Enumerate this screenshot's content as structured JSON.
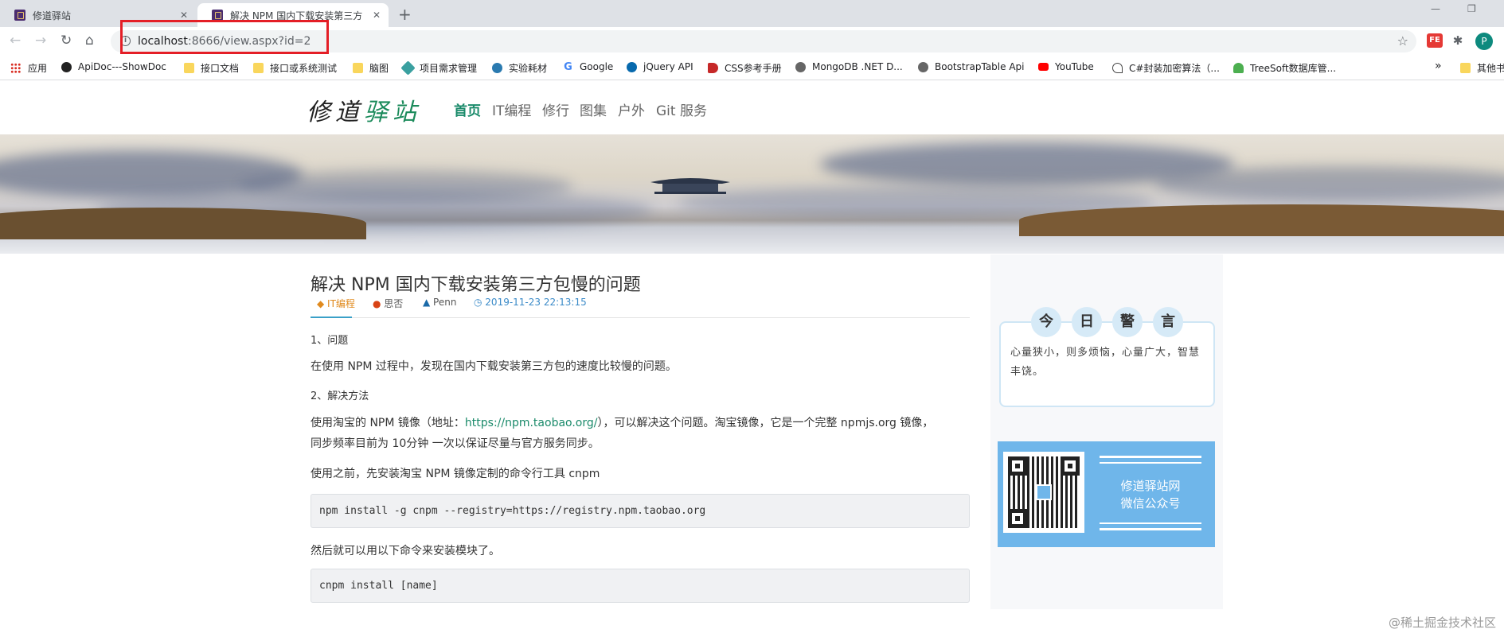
{
  "browser": {
    "tabs": [
      {
        "title": "修道驿站"
      },
      {
        "title": "解决 NPM 国内下载安装第三方"
      }
    ],
    "new_tab": "+",
    "window_controls": {
      "minimize": "—",
      "restore": "❐"
    },
    "nav": {
      "back": "←",
      "forward": "→",
      "reload": "↻",
      "home": "⌂"
    },
    "address": {
      "info": "i",
      "host": "localhost",
      "path": ":8666/view.aspx?id=2"
    },
    "star": "☆",
    "extensions": [
      {
        "label": "FE",
        "color": "#e53935"
      },
      {
        "label": "✱",
        "color": "#5f6368"
      }
    ],
    "avatar": "P",
    "bookmarks": [
      {
        "label": "应用",
        "icon": "apps-icon"
      },
      {
        "label": "ApiDoc---ShowDoc",
        "icon": "apidoc-icon"
      },
      {
        "label": "接口文档",
        "icon": "folder-icon"
      },
      {
        "label": "接口或系统测试",
        "icon": "folder-icon"
      },
      {
        "label": "脑图",
        "icon": "folder-icon"
      },
      {
        "label": "项目需求管理",
        "icon": "project-icon"
      },
      {
        "label": "实验耗材",
        "icon": "lab-icon"
      },
      {
        "label": "Google",
        "icon": "google-icon"
      },
      {
        "label": "jQuery API",
        "icon": "jquery-icon"
      },
      {
        "label": "CSS参考手册",
        "icon": "css-icon"
      },
      {
        "label": "MongoDB .NET D...",
        "icon": "globe-icon"
      },
      {
        "label": "BootstrapTable Api",
        "icon": "globe-icon"
      },
      {
        "label": "YouTube",
        "icon": "youtube-icon"
      },
      {
        "label": "C#封装加密算法（...",
        "icon": "csharp-icon"
      },
      {
        "label": "TreeSoft数据库管...",
        "icon": "treesoft-icon"
      },
      {
        "label": "»",
        "icon": "more-icon"
      },
      {
        "label": "其他书",
        "icon": "folder-icon"
      }
    ]
  },
  "site": {
    "logo_main": "修道",
    "logo_accent": "驿站",
    "nav": [
      "首页",
      "IT编程",
      "修行",
      "图集",
      "户外",
      "Git 服务"
    ]
  },
  "article": {
    "title": "解决 NPM 国内下载安装第三方包慢的问题",
    "meta": {
      "category": "IT编程",
      "source": "思否",
      "author": "Penn",
      "date": "2019-11-23 22:13:15"
    },
    "section1": "1、问题",
    "para1": "在使用 NPM 过程中，发现在国内下载安装第三方包的速度比较慢的问题。",
    "section2": "2、解决方法",
    "para2_a": "使用淘宝的 NPM 镜像（地址：",
    "para2_link": "https://npm.taobao.org/",
    "para2_b": "），可以解决这个问题。淘宝镜像，它是一个完整 npmjs.org 镜像，",
    "para2_c": "同步频率目前为 10分钟 一次以保证尽量与官方服务同步。",
    "para3": "使用之前，先安装淘宝 NPM 镜像定制的命令行工具 cnpm",
    "code1": "npm install -g cnpm --registry=https://registry.npm.taobao.org",
    "para4": "然后就可以用以下命令来安装模块了。",
    "code2": "cnpm install [name]"
  },
  "sidebar": {
    "quote_chars": [
      "今",
      "日",
      "警",
      "言"
    ],
    "quote": "心量狭小，则多烦恼，心量广大，智慧丰饶。",
    "wechat_line1": "修道驿站网",
    "wechat_line2": "微信公众号"
  },
  "watermark": "@稀土掘金技术社区",
  "colors": {
    "accent": "#1a8a6a",
    "highlight": "#e41e26",
    "wechat_bg": "#6fb6ea"
  }
}
